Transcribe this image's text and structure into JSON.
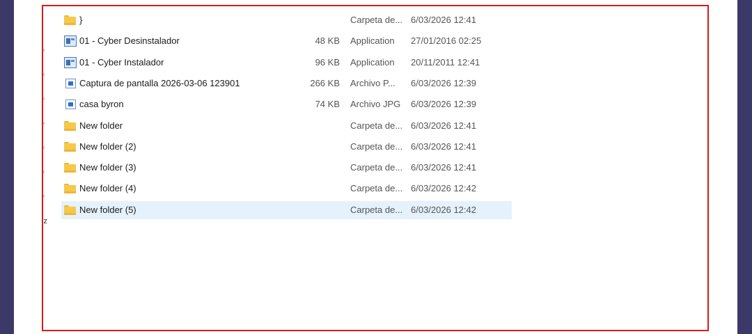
{
  "files": [
    {
      "name": "}",
      "size": "",
      "type": "Carpeta de...",
      "date": "6/03/2026 12:41",
      "icon": "folder-icon"
    },
    {
      "name": "01 - Cyber Desinstalador",
      "size": "48 KB",
      "type": "Application",
      "date": "27/01/2016 02:25",
      "icon": "application-icon"
    },
    {
      "name": "01 - Cyber Instalador",
      "size": "96 KB",
      "type": "Application",
      "date": "20/11/2011 12:41",
      "icon": "application-icon"
    },
    {
      "name": "Captura de pantalla 2026-03-06 123901",
      "size": "266 KB",
      "type": "Archivo P...",
      "date": "6/03/2026 12:39",
      "icon": "image-file-icon"
    },
    {
      "name": "casa byron",
      "size": "74 KB",
      "type": "Archivo JPG",
      "date": "6/03/2026 12:39",
      "icon": "image-file-icon"
    },
    {
      "name": "New folder",
      "size": "",
      "type": "Carpeta de...",
      "date": "6/03/2026 12:41",
      "icon": "folder-icon"
    },
    {
      "name": "New folder (2)",
      "size": "",
      "type": "Carpeta de...",
      "date": "6/03/2026 12:41",
      "icon": "folder-icon"
    },
    {
      "name": "New folder (3)",
      "size": "",
      "type": "Carpeta de...",
      "date": "6/03/2026 12:41",
      "icon": "folder-icon"
    },
    {
      "name": "New folder (4)",
      "size": "",
      "type": "Carpeta de...",
      "date": "6/03/2026 12:42",
      "icon": "folder-icon"
    },
    {
      "name": "New folder (5)",
      "size": "",
      "type": "Carpeta de...",
      "date": "6/03/2026 12:42",
      "icon": "folder-icon",
      "selected": true
    }
  ],
  "sidebar_partial_text": "iz",
  "colors": {
    "highlight_border": "#d61a1a",
    "selection_bg": "#e5f1fb",
    "frame": "#3a3968"
  }
}
